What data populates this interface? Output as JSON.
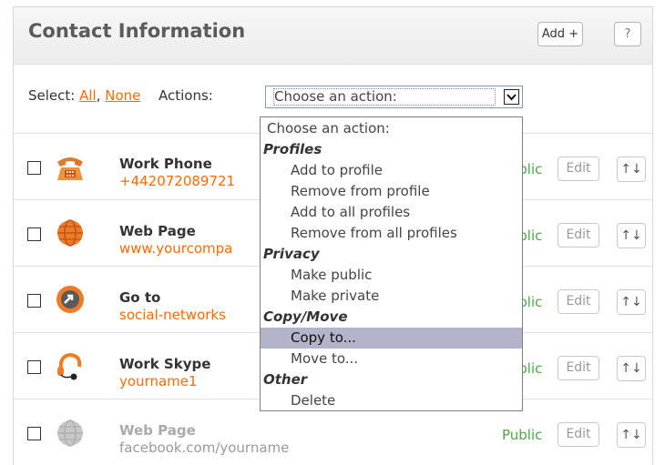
{
  "header": {
    "title": "Contact Information",
    "add_label": "Add +",
    "help_label": "?"
  },
  "select_bar": {
    "select_label": "Select:",
    "all_label": "All",
    "comma": ",",
    "none_label": "None",
    "actions_label": "Actions:"
  },
  "action_select": {
    "value": "Choose an action:",
    "arrow": "⌄"
  },
  "dropdown": {
    "first": "Choose an action:",
    "groups": [
      {
        "label": "Profiles",
        "items": [
          "Add to profile",
          "Remove from profile",
          "Add to all profiles",
          "Remove from all profiles"
        ]
      },
      {
        "label": "Privacy",
        "items": [
          "Make public",
          "Make private"
        ]
      },
      {
        "label": "Copy/Move",
        "items": [
          "Copy to...",
          "Move to..."
        ]
      },
      {
        "label": "Other",
        "items": [
          "Delete"
        ]
      }
    ],
    "highlighted": "Copy to..."
  },
  "rows": [
    {
      "label": "Work Phone",
      "value": "+442072089721",
      "privacy": "Public",
      "edit": "Edit",
      "sort": "↑↓",
      "icon": "phone-icon"
    },
    {
      "label": "Web Page",
      "value": "www.yourcompa",
      "privacy": "Public",
      "edit": "Edit",
      "sort": "↑↓",
      "icon": "globe-icon"
    },
    {
      "label": "Go to",
      "value": "social-networks",
      "privacy": "Public",
      "edit": "Edit",
      "sort": "↑↓",
      "icon": "go-to-arrow-icon"
    },
    {
      "label": "Work Skype",
      "value": "yourname1",
      "privacy": "Public",
      "edit": "Edit",
      "sort": "↑↓",
      "icon": "headset-icon"
    },
    {
      "label": "Web Page",
      "value": "facebook.com/yourname",
      "privacy": "Public",
      "edit": "Edit",
      "sort": "↑↓",
      "icon": "globe-icon"
    }
  ],
  "colors": {
    "accent": "#ff6a00",
    "public": "#4aa845",
    "highlight": "#b3b3c9"
  }
}
